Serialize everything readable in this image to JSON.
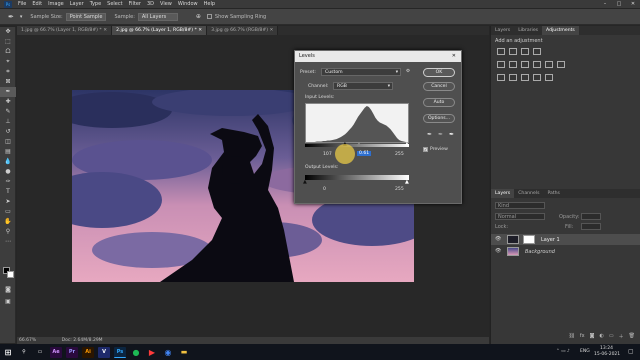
{
  "menubar": {
    "logo": "Ps",
    "items": [
      "File",
      "Edit",
      "Image",
      "Layer",
      "Type",
      "Select",
      "Filter",
      "3D",
      "View",
      "Window",
      "Help"
    ]
  },
  "options": {
    "sample_size_label": "Sample Size:",
    "sample_size_value": "Point Sample",
    "sample_label": "Sample:",
    "sample_value": "All Layers",
    "show_ring_label": "Show Sampling Ring"
  },
  "tabs": [
    {
      "label": "1.jpg @ 66.7% (Layer 1, RGB/8#) *"
    },
    {
      "label": "2.jpg @ 66.7% (Layer 1, RGB/8#) *"
    },
    {
      "label": "3.jpg @ 66.7% (RGB/8#)"
    }
  ],
  "status": {
    "zoom": "66.67%",
    "doc": "Doc: 2.64M/8.29M"
  },
  "levels": {
    "title": "Levels",
    "preset_label": "Preset:",
    "preset_value": "Custom",
    "channel_label": "Channel:",
    "channel_value": "RGB",
    "input_label": "Input Levels:",
    "input_black": "107",
    "input_gamma": "0.61",
    "input_white": "255",
    "output_label": "Output Levels:",
    "output_black": "0",
    "output_white": "255",
    "ok": "OK",
    "cancel": "Cancel",
    "auto": "Auto",
    "options": "Options...",
    "preview": "Preview",
    "histogram": [
      0,
      0,
      0,
      0,
      0,
      1,
      1,
      1,
      2,
      2,
      3,
      3,
      4,
      5,
      6,
      8,
      10,
      13,
      16,
      20,
      25,
      30,
      36,
      44,
      52,
      58,
      64,
      70,
      74,
      72,
      66,
      58,
      50,
      44,
      40,
      38,
      36,
      34,
      30,
      26,
      20,
      14,
      8,
      4,
      2,
      1,
      0,
      0
    ]
  },
  "adjustments": {
    "tabs": [
      "Layers",
      "Libraries",
      "Adjustments"
    ],
    "hint": "Add an adjustment"
  },
  "layers": {
    "tabs": [
      "Layers",
      "Channels",
      "Paths"
    ],
    "kind": "Kind",
    "blend": "Normal",
    "opacity_label": "Opacity:",
    "fill_label": "Fill:",
    "lock_label": "Lock:",
    "rows": [
      {
        "name": "Layer 1"
      },
      {
        "name": "Background"
      }
    ]
  },
  "taskbar": {
    "time": "13:24",
    "date": "15-06-2021",
    "lang": "ENG"
  }
}
